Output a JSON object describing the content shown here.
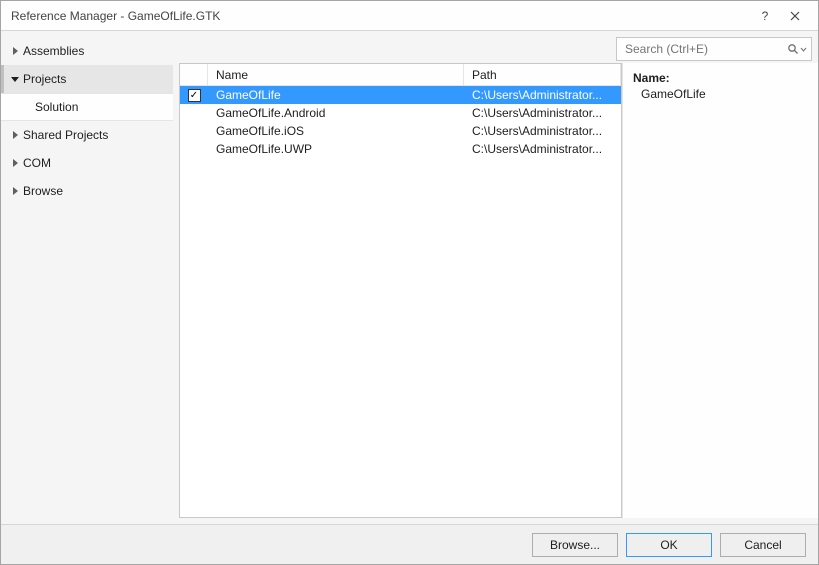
{
  "window": {
    "title": "Reference Manager - GameOfLife.GTK"
  },
  "sidebar": {
    "items": [
      {
        "id": "assemblies",
        "label": "Assemblies",
        "expanded": false
      },
      {
        "id": "projects",
        "label": "Projects",
        "expanded": true,
        "selected": true,
        "children": [
          {
            "id": "solution",
            "label": "Solution"
          }
        ]
      },
      {
        "id": "shared",
        "label": "Shared Projects",
        "expanded": false
      },
      {
        "id": "com",
        "label": "COM",
        "expanded": false
      },
      {
        "id": "browse",
        "label": "Browse",
        "expanded": false
      }
    ]
  },
  "search": {
    "placeholder": "Search (Ctrl+E)"
  },
  "grid": {
    "columns": {
      "name": "Name",
      "path": "Path"
    },
    "rows": [
      {
        "checked": true,
        "selected": true,
        "name": "GameOfLife",
        "path": "C:\\Users\\Administrator..."
      },
      {
        "checked": false,
        "selected": false,
        "name": "GameOfLife.Android",
        "path": "C:\\Users\\Administrator..."
      },
      {
        "checked": false,
        "selected": false,
        "name": "GameOfLife.iOS",
        "path": "C:\\Users\\Administrator..."
      },
      {
        "checked": false,
        "selected": false,
        "name": "GameOfLife.UWP",
        "path": "C:\\Users\\Administrator..."
      }
    ]
  },
  "details": {
    "label": "Name:",
    "value": "GameOfLife"
  },
  "footer": {
    "browse": "Browse...",
    "ok": "OK",
    "cancel": "Cancel"
  }
}
